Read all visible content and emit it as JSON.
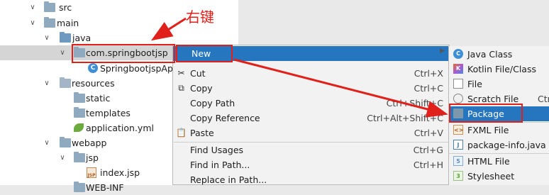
{
  "annotation": "右键",
  "tree": [
    {
      "id": "src",
      "label": "src",
      "arrow": "∨"
    },
    {
      "id": "main",
      "label": "main",
      "arrow": "∨"
    },
    {
      "id": "java",
      "label": "java",
      "arrow": "∨"
    },
    {
      "id": "pkg",
      "label": "com.springbootjsp",
      "arrow": "∨"
    },
    {
      "id": "app",
      "label": "SpringbootjspApp"
    },
    {
      "id": "resources",
      "label": "resources",
      "arrow": "∨"
    },
    {
      "id": "static",
      "label": "static"
    },
    {
      "id": "templates",
      "label": "templates"
    },
    {
      "id": "yml",
      "label": "application.yml"
    },
    {
      "id": "webapp",
      "label": "webapp",
      "arrow": "∨"
    },
    {
      "id": "jsp",
      "label": "jsp",
      "arrow": "∨"
    },
    {
      "id": "index",
      "label": "index.jsp"
    },
    {
      "id": "webinf",
      "label": "WEB-INF"
    }
  ],
  "context_menu": {
    "items": [
      {
        "label": "New",
        "shortcut": "",
        "icon": "",
        "submenu": true
      },
      {
        "label": "Cut",
        "shortcut": "Ctrl+X",
        "icon": "scissors-icon"
      },
      {
        "label": "Copy",
        "shortcut": "Ctrl+C",
        "icon": "copy-icon"
      },
      {
        "label": "Copy Path",
        "shortcut": "Ctrl+Shift+C",
        "icon": ""
      },
      {
        "label": "Copy Reference",
        "shortcut": "Ctrl+Alt+Shift+C",
        "icon": ""
      },
      {
        "label": "Paste",
        "shortcut": "Ctrl+V",
        "icon": "paste-icon"
      },
      {
        "label": "Find Usages",
        "shortcut": "Ctrl+G",
        "icon": ""
      },
      {
        "label": "Find in Path...",
        "shortcut": "Ctrl+H",
        "icon": ""
      },
      {
        "label": "Replace in Path...",
        "shortcut": "",
        "icon": ""
      }
    ]
  },
  "new_submenu": {
    "items": [
      {
        "label": "Java Class",
        "icon": "java-class-icon",
        "glyph": "C"
      },
      {
        "label": "Kotlin File/Class",
        "icon": "kotlin-icon",
        "glyph": "K"
      },
      {
        "label": "File",
        "icon": "file-icon",
        "glyph": ""
      },
      {
        "label": "Scratch File",
        "icon": "scratch-file-icon",
        "glyph": ""
      },
      {
        "label": "Package",
        "icon": "package-icon",
        "glyph": ""
      },
      {
        "label": "FXML File",
        "icon": "fxml-icon",
        "glyph": "<>"
      },
      {
        "label": "package-info.java",
        "icon": "package-info-icon",
        "glyph": "J"
      },
      {
        "label": "HTML File",
        "icon": "html-file-icon",
        "glyph": "5"
      },
      {
        "label": "Stylesheet",
        "icon": "stylesheet-icon",
        "glyph": "3"
      }
    ],
    "clipped_shortcut": "Ctr"
  },
  "colors": {
    "accent": "#2675bf",
    "annotation_red": "#e0201a"
  }
}
